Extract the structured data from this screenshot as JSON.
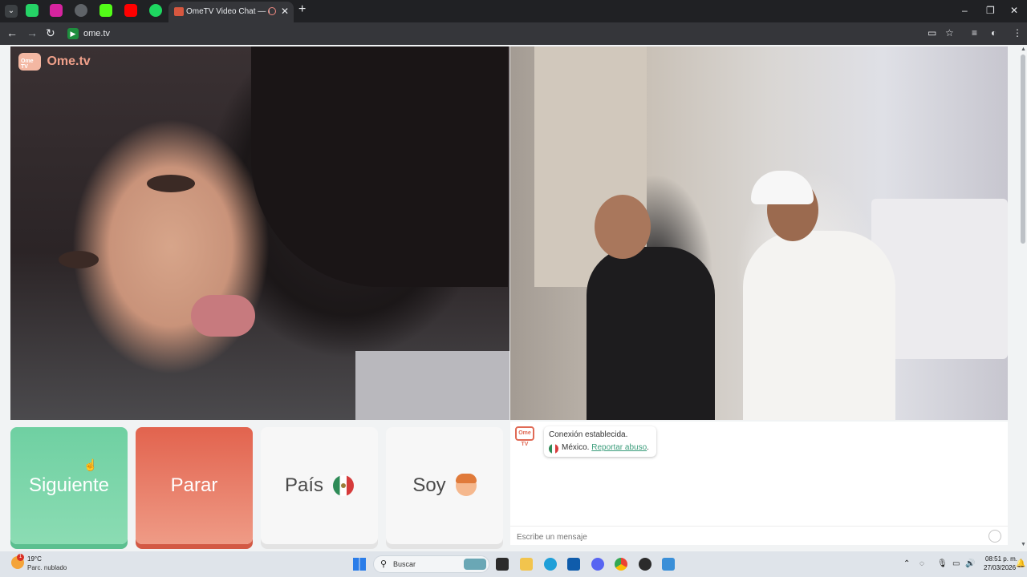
{
  "browser": {
    "tab_title": "OmeTV Video Chat — Ome",
    "url": "ome.tv",
    "pinned_tabs": [
      "whatsapp-icon",
      "instagram-icon",
      "chatgpt-icon",
      "kick-icon",
      "youtube-icon",
      "spotify-icon"
    ],
    "glyphs": {
      "back": "←",
      "forward": "→",
      "reload": "↻",
      "new_tab": "+",
      "minimize": "–",
      "maximize": "❐",
      "close": "✕",
      "tab_menu": "⌄",
      "tab_close": "✕",
      "bookmark": "☆",
      "menu": "⋮",
      "screen": "▭",
      "media": "≡",
      "profile": "◐"
    }
  },
  "page": {
    "logo_text": "Ome.tv",
    "logo_badge": "Ome TV",
    "buttons": {
      "next": "Siguiente",
      "stop": "Parar",
      "country": "País",
      "gender": "Soy"
    },
    "chat": {
      "chat_logo": "Ome TV",
      "status": "Conexión establecida.",
      "country": "México.",
      "report_link": "Reportar abuso",
      "report_suffix": ".",
      "input_placeholder": "Escribe un mensaje"
    },
    "colors": {
      "next": "#6fd0a2",
      "stop": "#e2634e",
      "link": "#3a9c7a"
    }
  },
  "taskbar": {
    "weather_badge": "1",
    "temperature": "19°C",
    "condition": "Parc. nublado",
    "search_placeholder": "Buscar",
    "time": "08:51 p. m.",
    "date": "27/03/2026",
    "tray": {
      "chevron": "⌃",
      "mic": "🎙",
      "speaker": "🔊",
      "network": "▭",
      "wifi": "◌",
      "bell": "🔔"
    }
  }
}
